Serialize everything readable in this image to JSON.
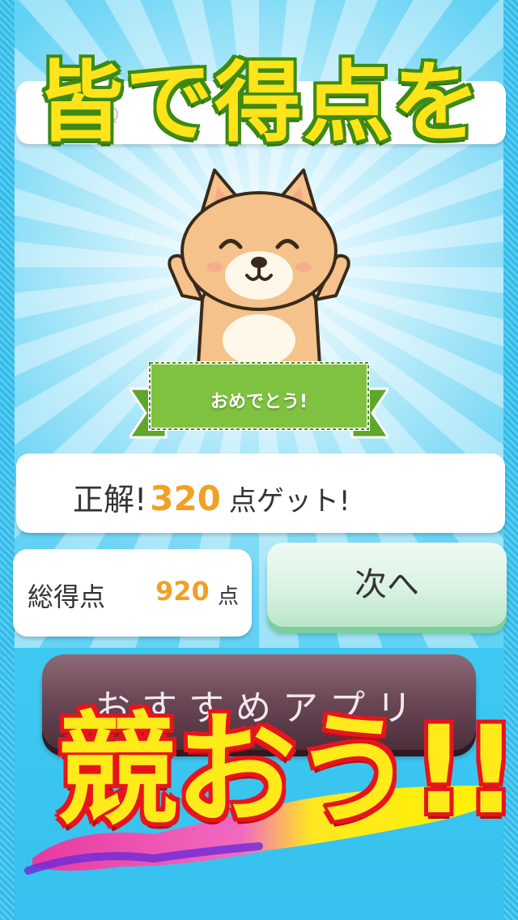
{
  "headline": "皆で得点を",
  "top_bar": {
    "hint": "Q"
  },
  "ribbon": {
    "label": "おめでとう!"
  },
  "result": {
    "prefix": "正解!",
    "score": "320",
    "suffix": "点ゲット!"
  },
  "total": {
    "label": "総得点",
    "value": "920",
    "unit": "点"
  },
  "next_button": {
    "label": "次へ"
  },
  "recommend_button": {
    "label": "おすすめアプリ"
  },
  "overlay": {
    "compete": "競おう!!"
  },
  "colors": {
    "sky": "#3fc6f0",
    "headline_fill": "#ffe41a",
    "headline_stroke": "#3c8a14",
    "score": "#f2a023",
    "ribbon": "#7fc23f",
    "next_button": "#d9f2e2",
    "recommend_button": "#6a4655",
    "compete_fill": "#ffea1a",
    "compete_stroke": "#e8141b"
  },
  "mascot": {
    "icon": "fox-dog-mascot-icon"
  }
}
